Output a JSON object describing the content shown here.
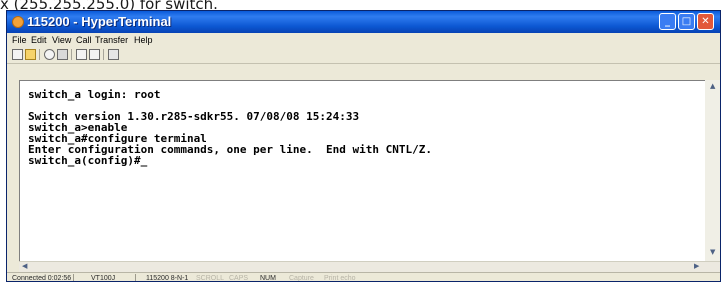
{
  "document_caption": "x (255.255.255.0) for switch.",
  "window": {
    "title": "115200 - HyperTerminal"
  },
  "menu": [
    {
      "id": "file",
      "label": "File"
    },
    {
      "id": "edit",
      "label": "Edit"
    },
    {
      "id": "view",
      "label": "View"
    },
    {
      "id": "call",
      "label": "Call"
    },
    {
      "id": "transfer",
      "label": "Transfer"
    },
    {
      "id": "help",
      "label": "Help"
    }
  ],
  "toolbar": {
    "icons": [
      "new-icon",
      "open-icon",
      "dial-icon",
      "disconnect-icon",
      "send-icon",
      "receive-icon",
      "properties-icon"
    ]
  },
  "terminal": {
    "lines": [
      "switch_a login: root",
      "Switch version 1.30.r285-sdkr55. 07/08/08 15:24:33",
      "switch_a>enable",
      "switch_a#configure terminal",
      "Enter configuration commands, one per line.  End with CNTL/Z.",
      "switch_a(config)#_"
    ]
  },
  "status": {
    "connected": "Connected 0:02:56",
    "emulation": "VT100J",
    "port_settings": "115200 8-N-1",
    "scroll": "SCROLL",
    "caps": "CAPS",
    "num": "NUM",
    "capture": "Capture",
    "print_echo": "Print echo"
  }
}
